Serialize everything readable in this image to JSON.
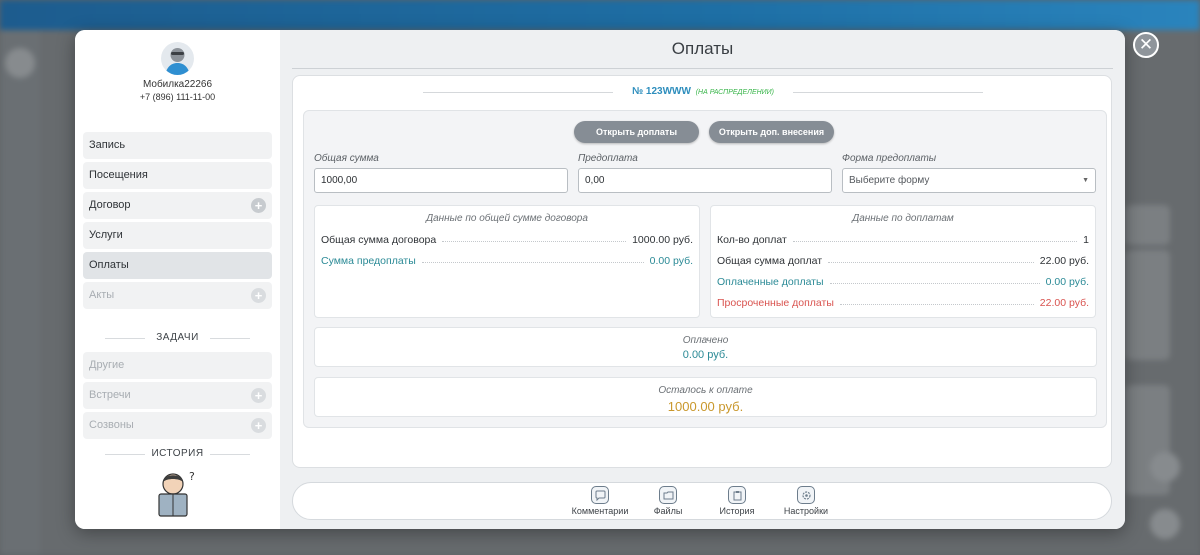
{
  "user": {
    "name": "Мобилка22266",
    "phone": "+7 (896) 111-11-00"
  },
  "menu": {
    "items": [
      {
        "label": "Запись"
      },
      {
        "label": "Посещения"
      },
      {
        "label": "Договор"
      },
      {
        "label": "Услуги"
      },
      {
        "label": "Оплаты"
      },
      {
        "label": "Акты"
      }
    ],
    "tasks_title": "ЗАДАЧИ",
    "tasks": [
      {
        "label": "Другие"
      },
      {
        "label": "Встречи"
      },
      {
        "label": "Созвоны"
      }
    ],
    "history_title": "ИСТОРИЯ"
  },
  "modal": {
    "title": "Оплаты",
    "contract_number": "№ 123WWW",
    "contract_status": "(НА РАСПРЕДЕЛЕНИИ)",
    "buttons": {
      "open_payments": "Открыть доплаты",
      "open_extra": "Открыть доп. внесения"
    },
    "fields": {
      "total_label": "Общая сумма",
      "total_value": "1000,00",
      "prepay_label": "Предоплата",
      "prepay_value": "0,00",
      "form_label": "Форма предоплаты",
      "form_placeholder": "Выберите форму"
    },
    "contract_data": {
      "title": "Данные по общей сумме договора",
      "rows": [
        {
          "label": "Общая сумма договора",
          "value": "1000.00 руб."
        },
        {
          "label": "Сумма предоплаты",
          "value": "0.00 руб."
        }
      ]
    },
    "extra_data": {
      "title": "Данные по доплатам",
      "rows": [
        {
          "label": "Кол-во доплат",
          "value": "1"
        },
        {
          "label": "Общая сумма доплат",
          "value": "22.00 руб."
        },
        {
          "label": "Оплаченные доплаты",
          "value": "0.00 руб."
        },
        {
          "label": "Просроченные доплаты",
          "value": "22.00 руб."
        }
      ]
    },
    "paid": {
      "label": "Оплачено",
      "value": "0.00 руб."
    },
    "remaining": {
      "label": "Осталось к оплате",
      "value": "1000.00 руб."
    }
  },
  "toolbar": [
    {
      "label": "Комментарии",
      "icon": "comment-icon"
    },
    {
      "label": "Файлы",
      "icon": "folder-icon"
    },
    {
      "label": "История",
      "icon": "clipboard-icon"
    },
    {
      "label": "Настройки",
      "icon": "gear-icon"
    }
  ],
  "colors": {
    "accent": "#2e8ebd",
    "teal": "#2b8a96",
    "danger": "#d9534f",
    "gold": "#c9982d",
    "status_green": "#39b54a"
  }
}
